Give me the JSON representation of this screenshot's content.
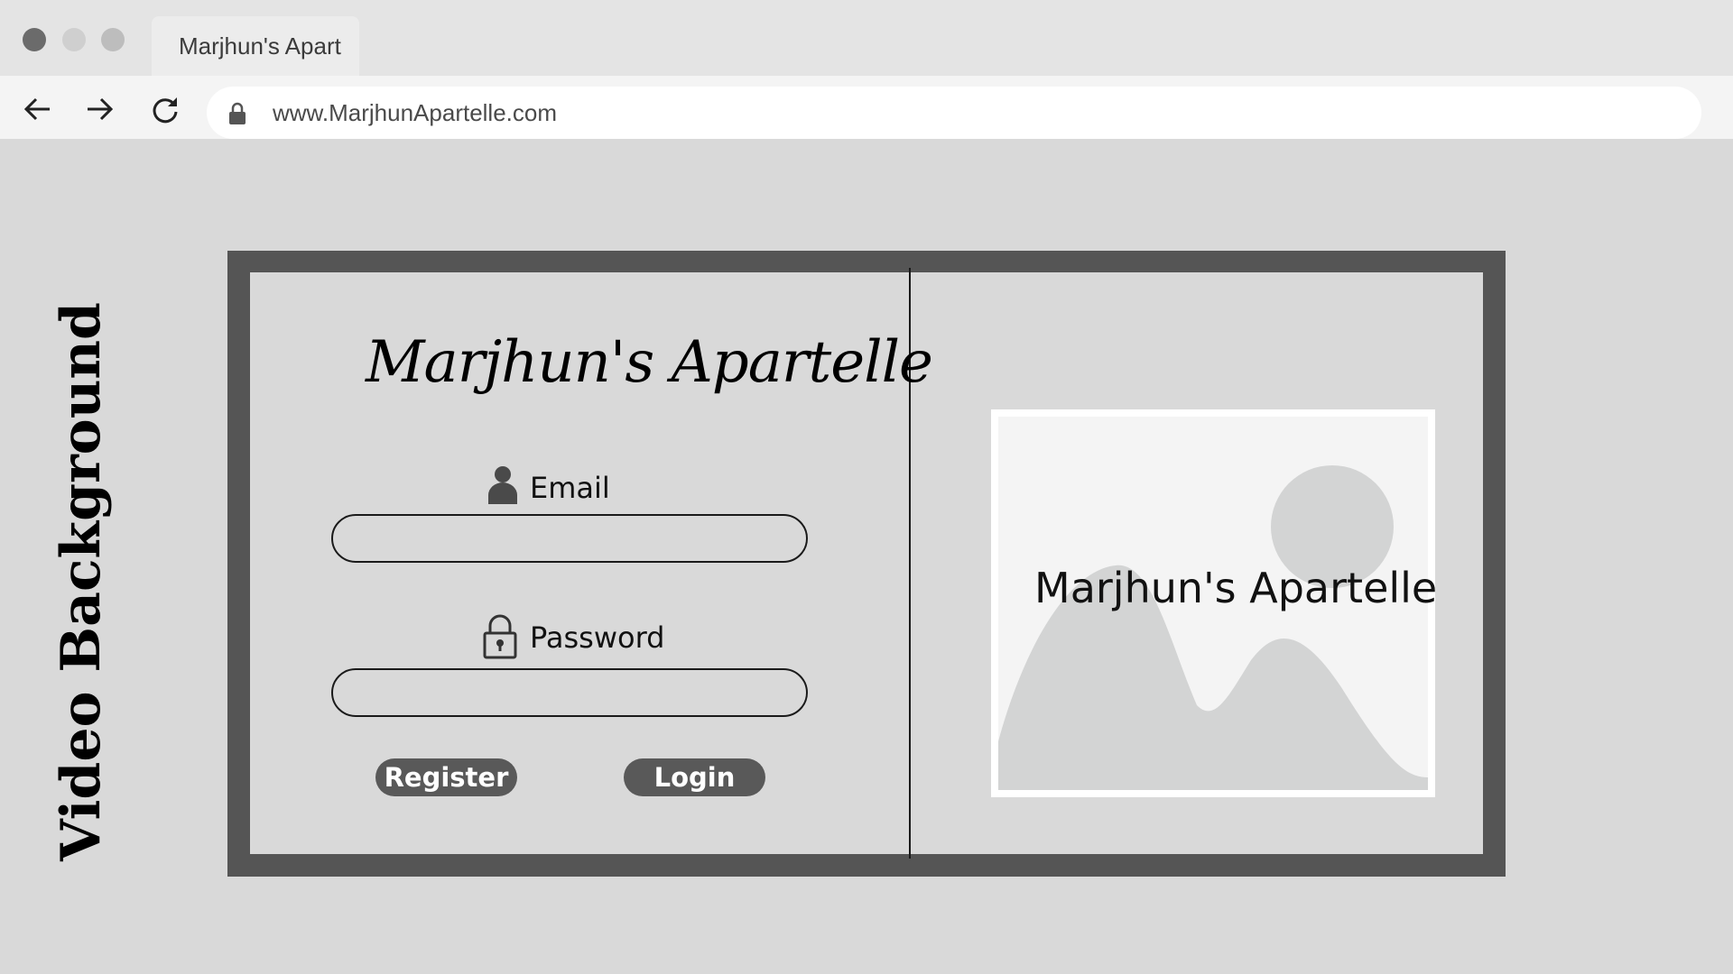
{
  "browser": {
    "tab_title": "Marjhun's Apart",
    "url": "www.MarjhunApartelle.com",
    "nav": {
      "back": "arrow-left-icon",
      "forward": "arrow-right-icon",
      "reload": "reload-icon"
    }
  },
  "side_label": "Video Background",
  "login": {
    "brand": "Marjhun's Apartelle",
    "email_label": "Email",
    "email_value": "",
    "password_label": "Password",
    "password_value": "",
    "register_label": "Register",
    "login_label": "Login"
  },
  "image_placeholder": {
    "caption": "Marjhun's Apartelle"
  },
  "colors": {
    "frame": "#555555",
    "panel": "#d9d9d9",
    "button": "#595959",
    "placeholder_shape": "#d3d4d4"
  }
}
